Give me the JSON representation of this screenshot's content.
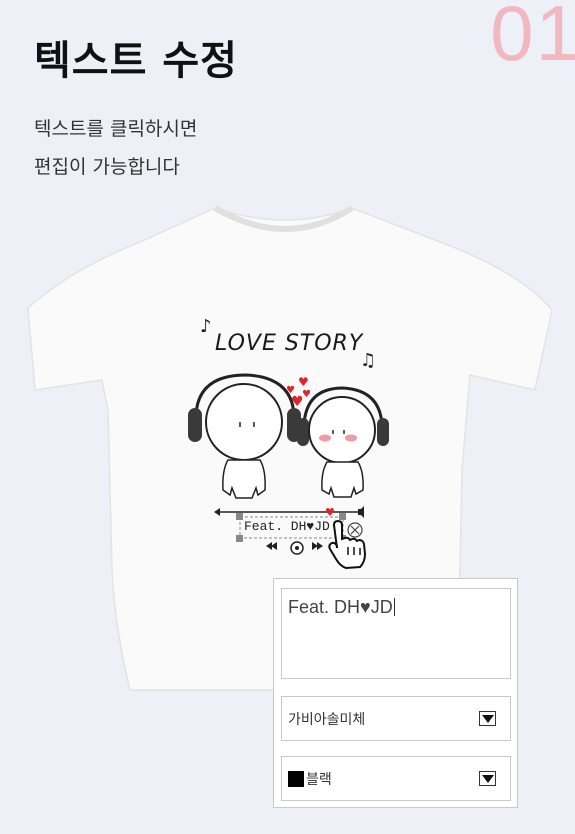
{
  "step": {
    "number": "01"
  },
  "header": {
    "title": "텍스트 수정"
  },
  "description": {
    "line1": "텍스트를 클릭하시면",
    "line2": "편집이 가능합니다"
  },
  "design": {
    "title": "LOVE STORY",
    "feat_text": "Feat. DH♥JD"
  },
  "editor": {
    "text_value": "Feat. DH♥JD",
    "font_select": {
      "selected": "가비아솔미체",
      "icon": "chevron-down-icon"
    },
    "color_select": {
      "selected": "블랙",
      "swatch_color": "#000000",
      "icon": "chevron-down-icon"
    }
  },
  "colors": {
    "accent_number": "#f2b8c0",
    "background": "#eef0f8",
    "heart": "#e0262b"
  }
}
